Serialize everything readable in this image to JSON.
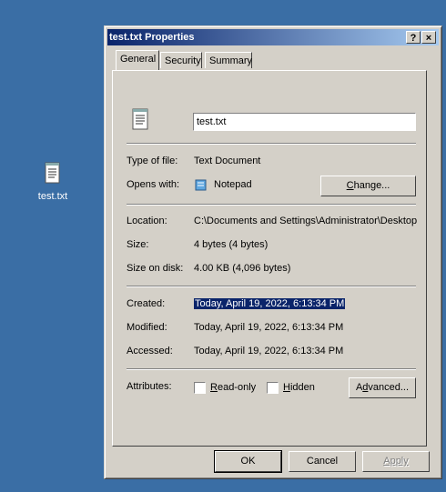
{
  "desktop": {
    "icon_label": "test.txt",
    "icon_name": "text-file-icon"
  },
  "dialog": {
    "title": "test.txt Properties",
    "help_glyph": "?",
    "close_glyph": "×",
    "tabs": [
      "General",
      "Security",
      "Summary"
    ],
    "filename": "test.txt",
    "type_label": "Type of file:",
    "type_value": "Text Document",
    "opens_label": "Opens with:",
    "opens_value": "Notepad",
    "change_button": "Change...",
    "location_label": "Location:",
    "location_value": "C:\\Documents and Settings\\Administrator\\Desktop",
    "size_label": "Size:",
    "size_value": "4 bytes (4 bytes)",
    "size_disk_label": "Size on disk:",
    "size_disk_value": "4.00 KB (4,096 bytes)",
    "created_label": "Created:",
    "created_value": "Today, April 19, 2022, 6:13:34 PM",
    "modified_label": "Modified:",
    "modified_value": "Today, April 19, 2022, 6:13:34 PM",
    "accessed_label": "Accessed:",
    "accessed_value": "Today, April 19, 2022, 6:13:34 PM",
    "attributes_label": "Attributes:",
    "readonly_label": "Read-only",
    "hidden_label": "Hidden",
    "advanced_button": "Advanced...",
    "ok_button": "OK",
    "cancel_button": "Cancel",
    "apply_button": "Apply"
  },
  "colors": {
    "desktop": "#3a6ea5",
    "titlebar": "#0a246a",
    "face": "#d4d0c8"
  }
}
